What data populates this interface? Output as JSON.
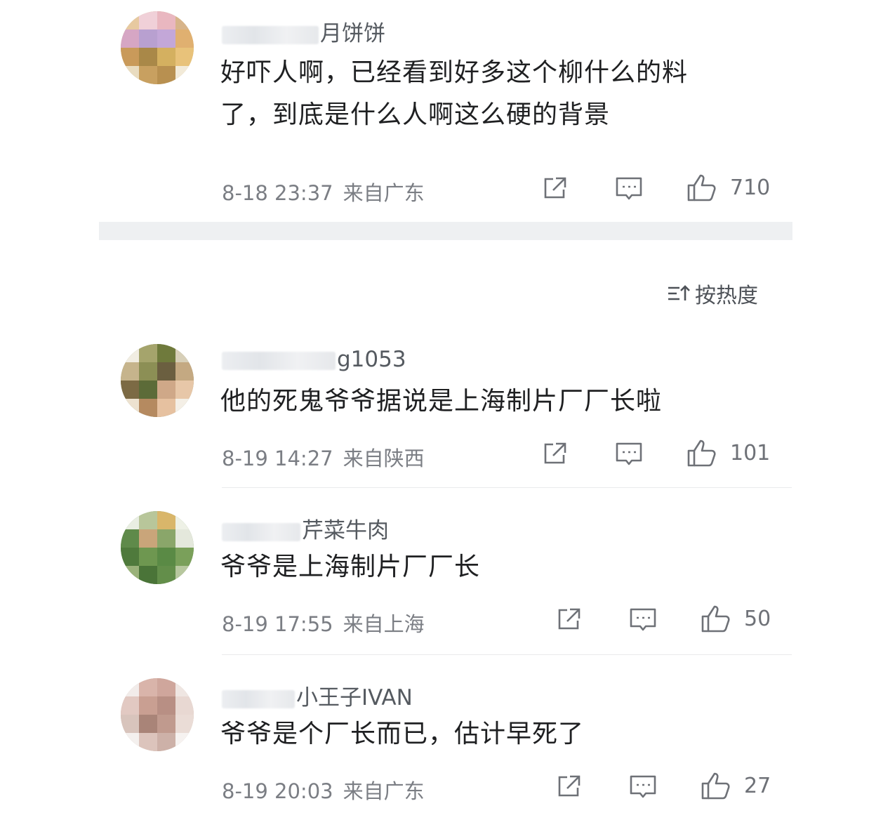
{
  "sort_label": "按热度",
  "comments": [
    {
      "username_visible": "月饼饼",
      "text_lines": [
        "好吓人啊，已经看到好多这个柳什么的料",
        "了，到底是什么人啊这么硬的背景"
      ],
      "time": "8-18 23:37",
      "location": "来自广东",
      "likes": "710"
    },
    {
      "username_visible": "g1053",
      "text_lines": [
        "他的死鬼爷爷据说是上海制片厂厂长啦"
      ],
      "time": "8-19 14:27",
      "location": "来自陕西",
      "likes": "101"
    },
    {
      "username_visible": "芹菜牛肉",
      "text_lines": [
        "爷爷是上海制片厂厂长"
      ],
      "time": "8-19 17:55",
      "location": "来自上海",
      "likes": "50"
    },
    {
      "username_visible": "小王子IVAN",
      "text_lines": [
        "爷爷是个厂长而已，估计早死了"
      ],
      "time": "8-19 20:03",
      "location": "来自广东",
      "likes": "27"
    }
  ],
  "colors": {
    "text": "#1f2022",
    "meta": "#7b7e84",
    "divider": "#eef0f2"
  },
  "icons": [
    "share-icon",
    "comment-icon",
    "like-icon",
    "sort-icon"
  ]
}
